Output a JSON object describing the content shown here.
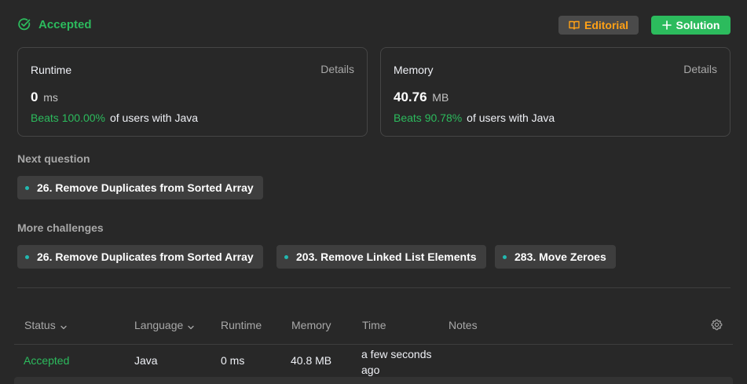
{
  "result": {
    "status": "Accepted",
    "editorial_label": "Editorial",
    "solution_label": "Solution"
  },
  "runtime": {
    "label": "Runtime",
    "details": "Details",
    "value": "0",
    "unit": "ms",
    "beats_pct": "Beats 100.00%",
    "beats_rest": "of users with Java"
  },
  "memory": {
    "label": "Memory",
    "details": "Details",
    "value": "40.76",
    "unit": "MB",
    "beats_pct": "Beats 90.78%",
    "beats_rest": "of users with Java"
  },
  "next_question": {
    "title": "Next question",
    "items": [
      "26. Remove Duplicates from Sorted Array"
    ]
  },
  "more_challenges": {
    "title": "More challenges",
    "items": [
      "26. Remove Duplicates from Sorted Array",
      "203. Remove Linked List Elements",
      "283. Move Zeroes"
    ]
  },
  "table": {
    "headers": [
      "Status",
      "Language",
      "Runtime",
      "Memory",
      "Time",
      "Notes"
    ],
    "rows": [
      {
        "status": "Accepted",
        "language": "Java",
        "runtime": "0 ms",
        "memory": "40.8 MB",
        "time": "a few seconds ago",
        "notes": ""
      }
    ]
  },
  "colors": {
    "accent_green": "#2cbb5d",
    "accent_orange": "#ffa116",
    "dot_teal": "#22b8b0",
    "background": "#282828"
  },
  "icons": {
    "status": "check-circle-icon",
    "editorial": "book-icon",
    "solution": "plus-icon",
    "sort": "chevron-down-icon",
    "settings": "gear-icon"
  }
}
